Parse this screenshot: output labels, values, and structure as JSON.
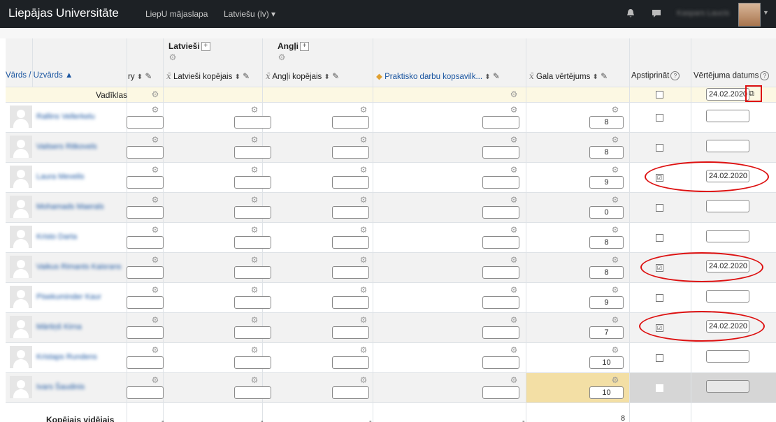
{
  "nav": {
    "brand": "Liepājas Universitāte",
    "links": [
      "LiepU mājaslapa",
      "Latviešu (lv) ▾"
    ],
    "username": "Kaspars Laucis",
    "icons": [
      "bell-icon",
      "chat-icon"
    ]
  },
  "table": {
    "categories": [
      {
        "label": "Latvieši"
      },
      {
        "label": "Angļi"
      }
    ],
    "columns": {
      "name": "Vārds / Uzvārds ▲",
      "summary_truncated": "ry",
      "latviesi_total": "Latvieši kopējais",
      "angli_total": "Angļi kopējais",
      "practical": "Praktisko darbu kopsavilk...",
      "final": "Gala vērtējums",
      "approve": "Apstiprināt",
      "date": "Vērtējuma datums"
    },
    "controls_label": "Vadīklas",
    "controls_date": "24.02.2020",
    "rows": [
      {
        "name": "Rallins Vellerkelu",
        "grade": "8",
        "approved": false,
        "date": ""
      },
      {
        "name": "Vaitsers Ritkovels",
        "grade": "8",
        "approved": false,
        "date": ""
      },
      {
        "name": "Laura Mevelis",
        "grade": "9",
        "approved": true,
        "date": "24.02.2020"
      },
      {
        "name": "Mohamads Maerals",
        "grade": "0",
        "approved": false,
        "date": ""
      },
      {
        "name": "Kristo Darta",
        "grade": "8",
        "approved": false,
        "date": ""
      },
      {
        "name": "Vaikus Rimants Kaisrans",
        "grade": "8",
        "approved": true,
        "date": "24.02.2020"
      },
      {
        "name": "Pisekuminder Kaur",
        "grade": "9",
        "approved": false,
        "date": ""
      },
      {
        "name": "Mārtiņš Kirna",
        "grade": "7",
        "approved": true,
        "date": "24.02.2020"
      },
      {
        "name": "Kristaps Rundens",
        "grade": "10",
        "approved": false,
        "date": ""
      },
      {
        "name": "Ivars Šaudinis",
        "grade": "10",
        "approved": false,
        "date": ""
      }
    ],
    "footer": {
      "label": "Kopējais vidējais",
      "dash": "-",
      "final_avg": "8"
    }
  }
}
